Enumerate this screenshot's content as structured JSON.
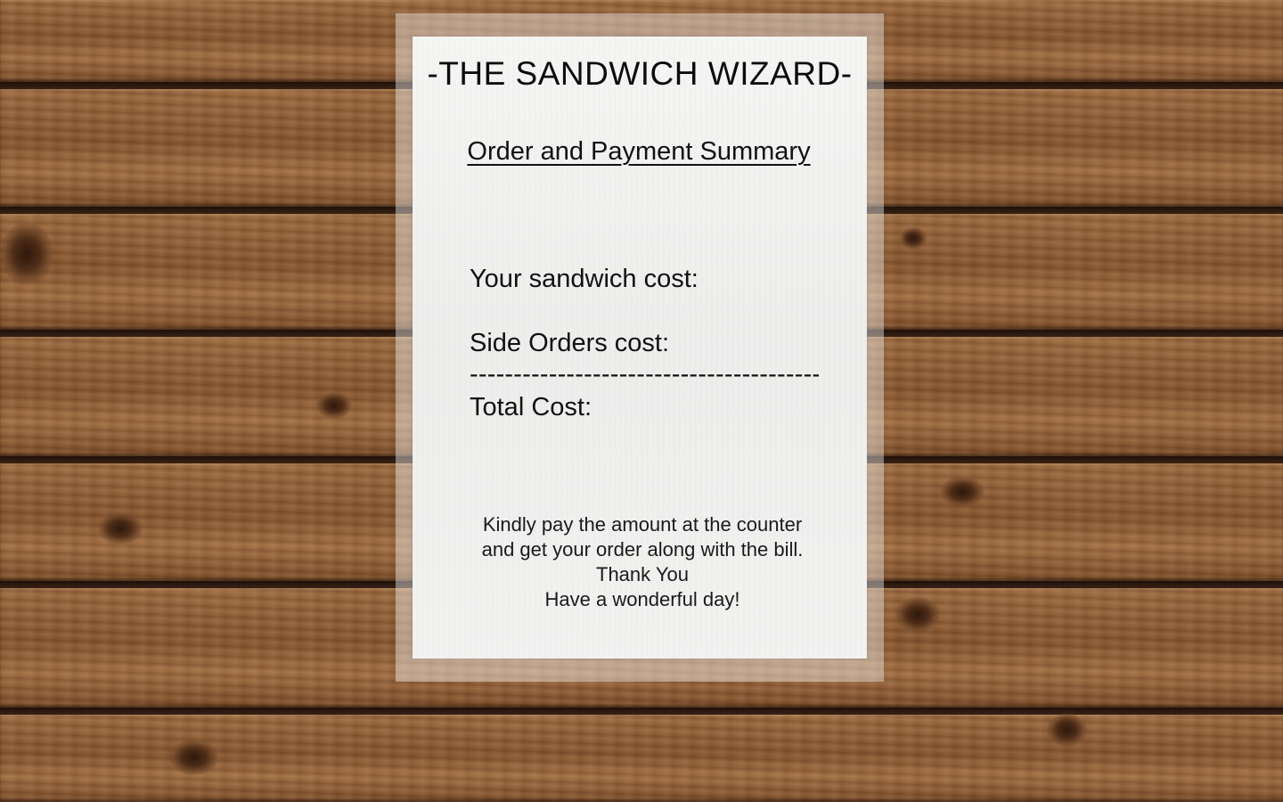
{
  "receipt": {
    "brand": "-THE SANDWICH WIZARD-",
    "summary_title": "Order and Payment Summary",
    "sandwich_cost_label": "Your sandwich cost:",
    "side_orders_cost_label": "Side Orders cost:",
    "divider": "-----------------------------------------",
    "total_cost_label": "Total Cost:",
    "note_lines": [
      "Kindly pay the amount at the counter",
      "and get your order along with the bill.",
      "Thank You",
      "Have a wonderful day!"
    ]
  },
  "colors": {
    "paper": "#f3f3f2",
    "wood": "#8a5a33",
    "text": "#111111"
  }
}
